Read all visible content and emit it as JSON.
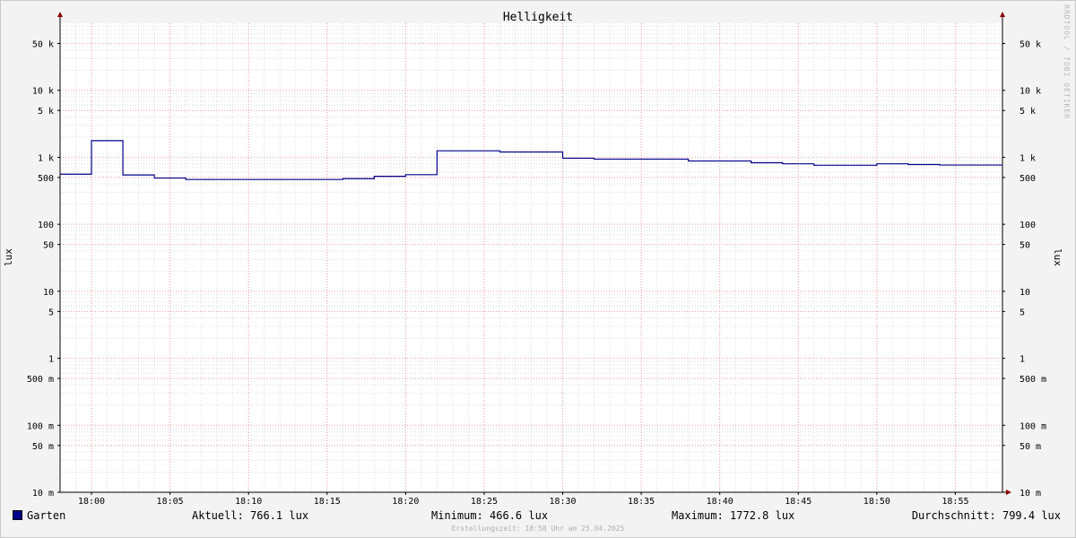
{
  "chart_data": {
    "type": "line",
    "title": "Helligkeit",
    "ylabel_left": "lux",
    "ylabel_right": "lux",
    "yscale": "log",
    "ylim": [
      0.01,
      100000
    ],
    "ytick_labels": [
      {
        "value": 0.01,
        "label": "10 m"
      },
      {
        "value": 0.05,
        "label": "50 m"
      },
      {
        "value": 0.1,
        "label": "100 m"
      },
      {
        "value": 0.5,
        "label": "500 m"
      },
      {
        "value": 1,
        "label": "1"
      },
      {
        "value": 5,
        "label": "5"
      },
      {
        "value": 10,
        "label": "10"
      },
      {
        "value": 50,
        "label": "50"
      },
      {
        "value": 100,
        "label": "100"
      },
      {
        "value": 500,
        "label": "500"
      },
      {
        "value": 1000,
        "label": "1 k"
      },
      {
        "value": 5000,
        "label": "5 k"
      },
      {
        "value": 10000,
        "label": "10 k"
      },
      {
        "value": 50000,
        "label": "50 k"
      }
    ],
    "xlim": [
      "17:58",
      "18:58"
    ],
    "xtick_labels": [
      "18:00",
      "18:05",
      "18:10",
      "18:15",
      "18:20",
      "18:25",
      "18:30",
      "18:35",
      "18:40",
      "18:45",
      "18:50",
      "18:55"
    ],
    "grid": true,
    "legend_position": "bottom-left",
    "series": [
      {
        "name": "Garten",
        "color": "#00008b",
        "steps": [
          {
            "t": "17:58",
            "y": 560
          },
          {
            "t": "18:00",
            "y": 1772.8
          },
          {
            "t": "18:02",
            "y": 545
          },
          {
            "t": "18:04",
            "y": 490
          },
          {
            "t": "18:06",
            "y": 466.6
          },
          {
            "t": "18:16",
            "y": 480
          },
          {
            "t": "18:18",
            "y": 520
          },
          {
            "t": "18:20",
            "y": 550
          },
          {
            "t": "18:22",
            "y": 1250
          },
          {
            "t": "18:26",
            "y": 1200
          },
          {
            "t": "18:30",
            "y": 970
          },
          {
            "t": "18:32",
            "y": 940
          },
          {
            "t": "18:38",
            "y": 880
          },
          {
            "t": "18:42",
            "y": 830
          },
          {
            "t": "18:44",
            "y": 800
          },
          {
            "t": "18:46",
            "y": 760
          },
          {
            "t": "18:50",
            "y": 800
          },
          {
            "t": "18:52",
            "y": 780
          },
          {
            "t": "18:54",
            "y": 766.1
          },
          {
            "t": "18:58",
            "y": 766.1
          }
        ]
      }
    ]
  },
  "legend": {
    "series_label": "Garten",
    "current": "Aktuell: 766.1 lux",
    "minimum": "Minimum: 466.6 lux",
    "maximum": "Maximum: 1772.8 lux",
    "average": "Durchschnitt: 799.4 lux"
  },
  "footer": "Erstellungszeit: 18:58 Uhr am 25.04.2025",
  "watermark": "RRDTOOL / TOBI OETIKER"
}
